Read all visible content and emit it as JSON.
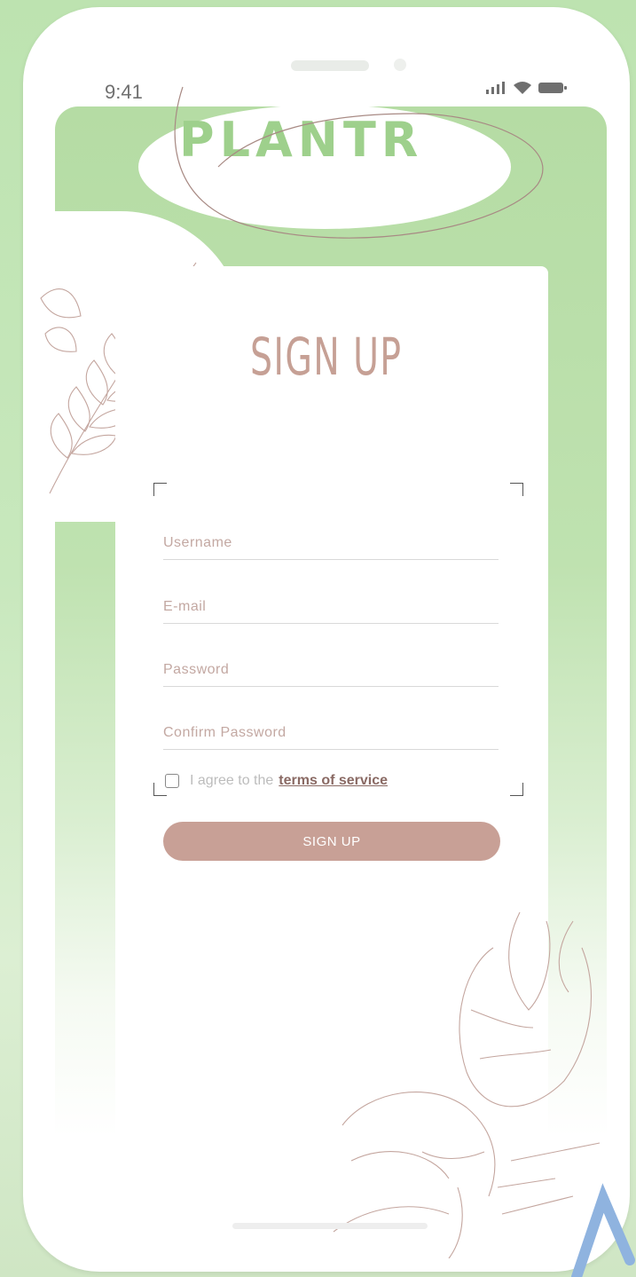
{
  "app": {
    "logo_text": "PLANTR"
  },
  "status_bar": {
    "time": "9:41"
  },
  "signup": {
    "title": "SIGN UP",
    "fields": {
      "username_placeholder": "Username",
      "email_placeholder": "E-mail",
      "password_placeholder": "Password",
      "confirm_password_placeholder": "Confirm Password"
    },
    "agree_text": "I agree to the",
    "terms_link": "terms of service",
    "button_label": "SIGN UP"
  },
  "colors": {
    "background_green": "#bde3b0",
    "logo_green": "#9ed08c",
    "accent_rose": "#c8a096",
    "title_rose": "#c6a095"
  },
  "icons": {
    "signal": "cellular-signal-icon",
    "wifi": "wifi-icon",
    "battery": "battery-icon",
    "fern": "fern-leaf-illustration",
    "monstera": "monstera-leaf-illustration"
  }
}
